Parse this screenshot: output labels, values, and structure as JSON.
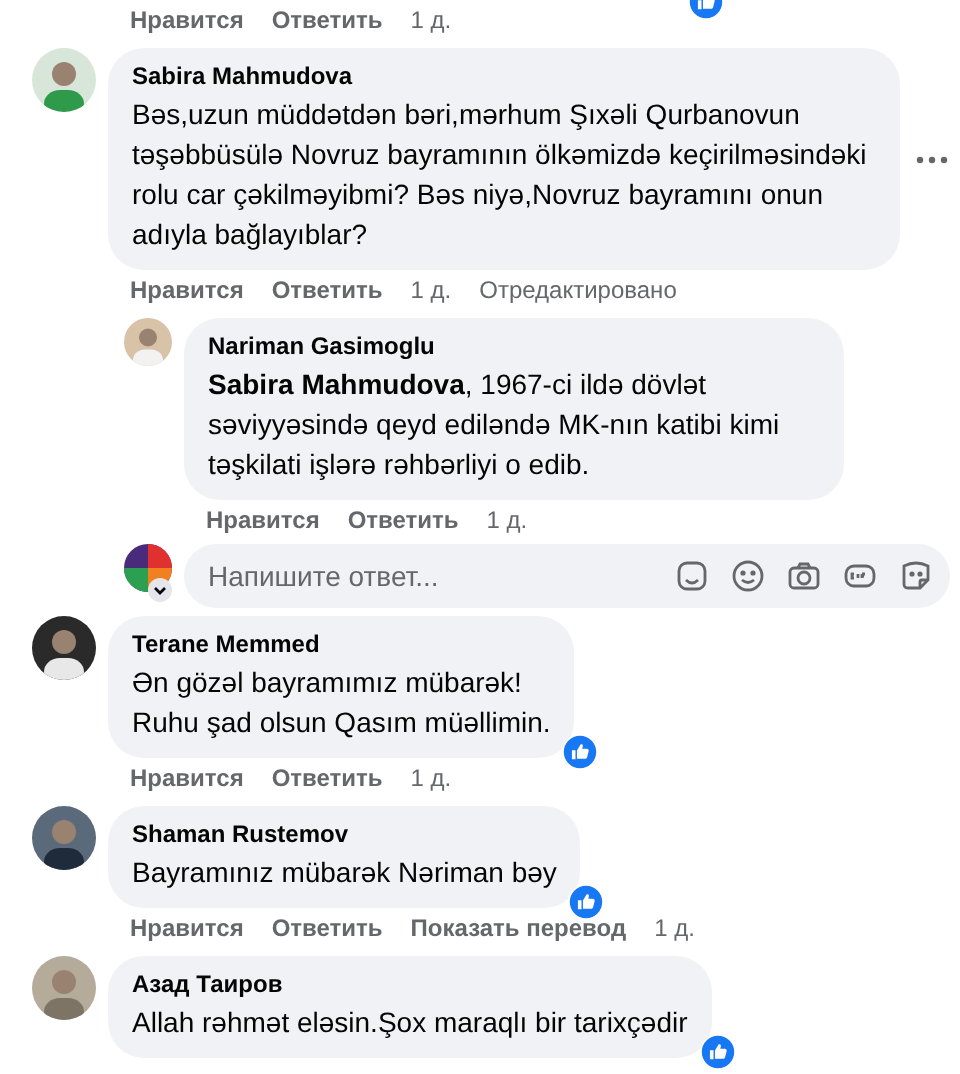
{
  "top_actions": [
    {
      "label": "Нравится",
      "kind": "link"
    },
    {
      "label": "Ответить",
      "kind": "link"
    },
    {
      "label": "1 д.",
      "kind": "time"
    }
  ],
  "top_reaction": true,
  "comments": [
    {
      "author": "Sabira Mahmudova",
      "text": "Bəs,uzun müddətdən bəri,mərhum Şıxəli Qurbanovun təşəbbüsülə Novruz bayramının ölkəmizdə keçirilməsindəki rolu car çəkilməyibmi? Bəs niyə,Novruz bayramını onun adıyla bağlayıblar?",
      "more": true,
      "actions": [
        {
          "label": "Нравится",
          "kind": "link"
        },
        {
          "label": "Ответить",
          "kind": "link"
        },
        {
          "label": "1 д.",
          "kind": "time"
        },
        {
          "label": "Отредактировано",
          "kind": "note"
        }
      ],
      "replies": [
        {
          "author": "Nariman Gasimoglu",
          "text": "**Sabira Mahmudova**, 1967-ci ildə dövlət səviyyəsində qeyd ediləndə MK-nın katibi kimi təşkilati işlərə rəhbərliyi o edib.",
          "actions": [
            {
              "label": "Нравится",
              "kind": "link"
            },
            {
              "label": "Ответить",
              "kind": "link"
            },
            {
              "label": "1 д.",
              "kind": "time"
            }
          ]
        }
      ],
      "reply_box": {
        "placeholder": "Напишите ответ..."
      }
    },
    {
      "author": "Terane Memmed",
      "text": "Ən gözəl bayramımız mübarək!\nRuhu şad olsun Qasım müəllimin.",
      "reaction": true,
      "actions": [
        {
          "label": "Нравится",
          "kind": "link"
        },
        {
          "label": "Ответить",
          "kind": "link"
        },
        {
          "label": "1 д.",
          "kind": "time"
        }
      ]
    },
    {
      "author": "Shaman Rustemov",
      "text": "Bayramınız mübarək Nəriman bəy",
      "reaction": true,
      "actions": [
        {
          "label": "Нравится",
          "kind": "link"
        },
        {
          "label": "Ответить",
          "kind": "link"
        },
        {
          "label": "Показать перевод",
          "kind": "link"
        },
        {
          "label": "1 д.",
          "kind": "time"
        }
      ]
    },
    {
      "author": "Азад Таиров",
      "text": "Allah rəhmət eləsin.Şox maraqlı bir tarixçədir",
      "reaction": true
    }
  ]
}
